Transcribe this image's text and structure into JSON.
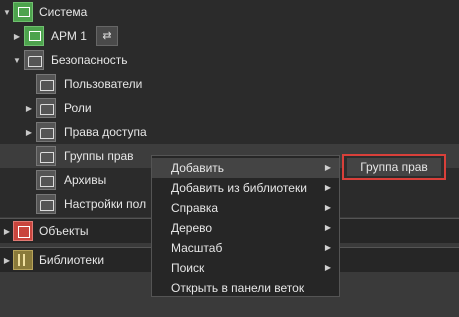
{
  "tree": {
    "system_label": "Система",
    "arm_label": "АРМ 1",
    "node_button_glyph": "⇄",
    "security_label": "Безопасность",
    "children": [
      {
        "label": "Пользователи"
      },
      {
        "label": "Роли"
      },
      {
        "label": "Права доступа"
      },
      {
        "label": "Группы прав"
      },
      {
        "label": "Архивы"
      },
      {
        "label": "Настройки пол"
      }
    ]
  },
  "panels": {
    "objects_label": "Объекты",
    "libraries_label": "Библиотеки"
  },
  "context_menu": {
    "items": [
      {
        "label": "Добавить",
        "submenu": true,
        "highlighted": true
      },
      {
        "label": "Добавить из библиотеки",
        "submenu": true
      },
      {
        "label": "Справка",
        "submenu": true
      },
      {
        "label": "Дерево",
        "submenu": true
      },
      {
        "label": "Масштаб",
        "submenu": true
      },
      {
        "label": "Поиск",
        "submenu": true
      },
      {
        "label": "Открыть в панели веток",
        "submenu": false
      }
    ]
  },
  "submenu": {
    "item_label": "Группа прав",
    "highlight_color": "#d9403a"
  },
  "glyphs": {
    "expanded": "▼",
    "collapsed": "▶",
    "submenu_arrow": "▶"
  }
}
